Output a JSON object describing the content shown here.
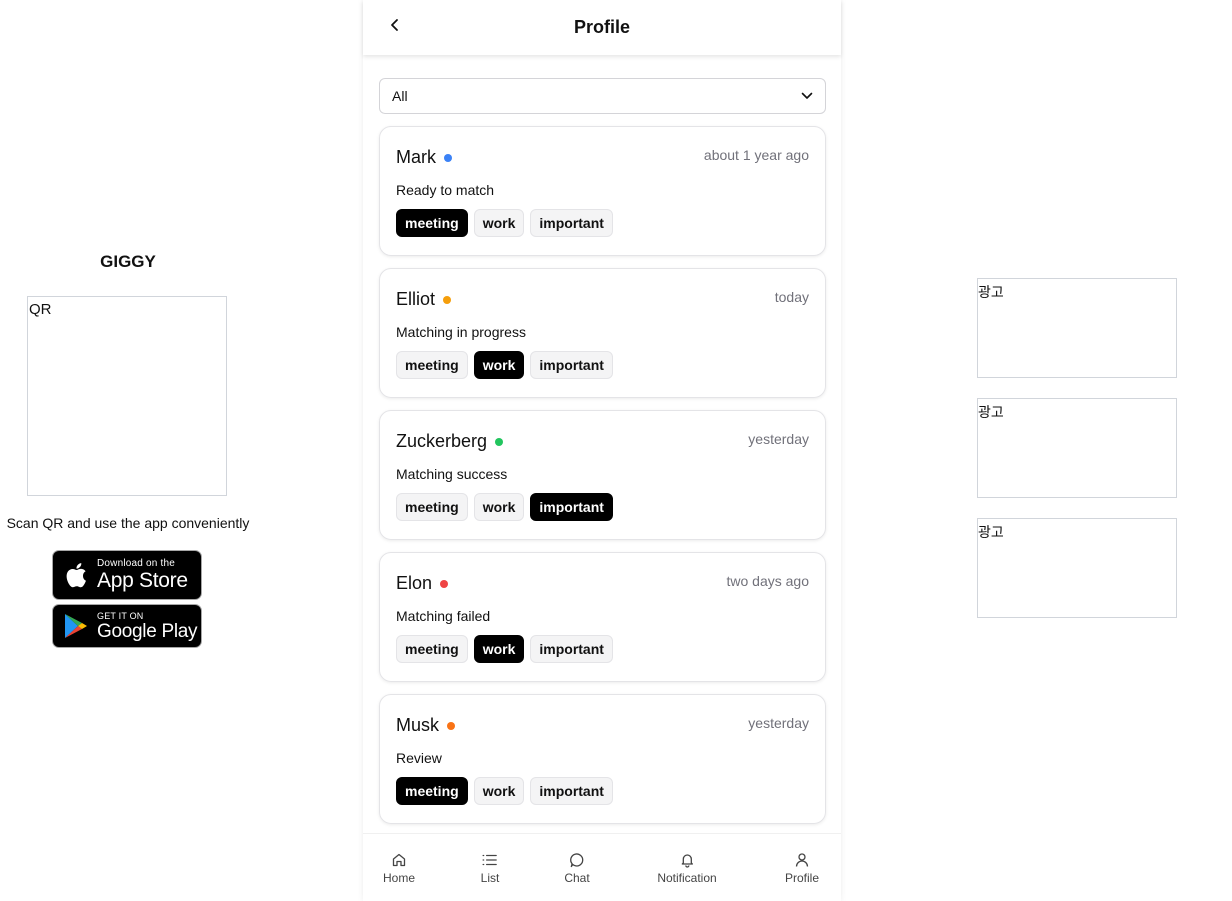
{
  "promo": {
    "brand": "GIGGY",
    "qr_placeholder": "QR",
    "caption": "Scan QR and use the app conveniently",
    "app_store": {
      "small": "Download on the",
      "big": "App Store"
    },
    "google_play": {
      "small": "GET IT ON",
      "big": "Google Play"
    }
  },
  "header": {
    "title": "Profile"
  },
  "filter": {
    "selected": "All"
  },
  "cards": [
    {
      "name": "Mark",
      "dot_color": "#3b82f6",
      "time": "about 1 year ago",
      "status": "Ready to match",
      "tags": [
        {
          "label": "meeting",
          "active": true
        },
        {
          "label": "work",
          "active": false
        },
        {
          "label": "important",
          "active": false
        }
      ]
    },
    {
      "name": "Elliot",
      "dot_color": "#f59e0b",
      "time": "today",
      "status": "Matching in progress",
      "tags": [
        {
          "label": "meeting",
          "active": false
        },
        {
          "label": "work",
          "active": true
        },
        {
          "label": "important",
          "active": false
        }
      ]
    },
    {
      "name": "Zuckerberg",
      "dot_color": "#22c55e",
      "time": "yesterday",
      "status": "Matching success",
      "tags": [
        {
          "label": "meeting",
          "active": false
        },
        {
          "label": "work",
          "active": false
        },
        {
          "label": "important",
          "active": true
        }
      ]
    },
    {
      "name": "Elon",
      "dot_color": "#ef4444",
      "time": "two days ago",
      "status": "Matching failed",
      "tags": [
        {
          "label": "meeting",
          "active": false
        },
        {
          "label": "work",
          "active": true
        },
        {
          "label": "important",
          "active": false
        }
      ]
    },
    {
      "name": "Musk",
      "dot_color": "#f97316",
      "time": "yesterday",
      "status": "Review",
      "tags": [
        {
          "label": "meeting",
          "active": true
        },
        {
          "label": "work",
          "active": false
        },
        {
          "label": "important",
          "active": false
        }
      ]
    }
  ],
  "nav": [
    {
      "label": "Home",
      "icon": "home-icon"
    },
    {
      "label": "List",
      "icon": "list-icon"
    },
    {
      "label": "Chat",
      "icon": "chat-icon"
    },
    {
      "label": "Notification",
      "icon": "bell-icon"
    },
    {
      "label": "Profile",
      "icon": "user-icon"
    }
  ],
  "ads": [
    "광고",
    "광고",
    "광고"
  ]
}
